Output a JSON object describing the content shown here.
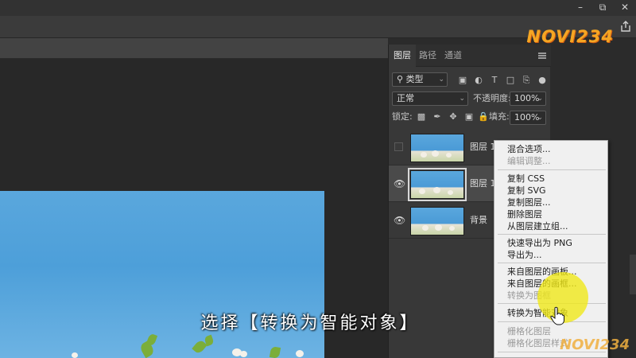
{
  "logo": {
    "text": "NOVI234"
  },
  "panel": {
    "tabs": [
      "图层",
      "路径",
      "通道"
    ],
    "filter": {
      "label": "类型"
    },
    "blend_mode": "正常",
    "opacity": {
      "label": "不透明度:",
      "value": "100%"
    },
    "lock_label": "锁定:",
    "fill": {
      "label": "填充:",
      "value": "100%"
    },
    "layers": [
      {
        "name": "图层 1",
        "visible": false,
        "selected": false
      },
      {
        "name": "图层 1",
        "visible": true,
        "selected": true
      },
      {
        "name": "背景",
        "visible": true,
        "selected": false
      }
    ]
  },
  "context_menu": {
    "groups": [
      [
        {
          "label": "混合选项...",
          "enabled": true
        },
        {
          "label": "编辑调整...",
          "enabled": false
        }
      ],
      [
        {
          "label": "复制 CSS",
          "enabled": true
        },
        {
          "label": "复制 SVG",
          "enabled": true
        },
        {
          "label": "复制图层...",
          "enabled": true
        },
        {
          "label": "删除图层",
          "enabled": true
        },
        {
          "label": "从图层建立组...",
          "enabled": true
        }
      ],
      [
        {
          "label": "快速导出为 PNG",
          "enabled": true
        },
        {
          "label": "导出为...",
          "enabled": true
        }
      ],
      [
        {
          "label": "来自图层的画板...",
          "enabled": true
        },
        {
          "label": "来自图层的画框...",
          "enabled": true
        },
        {
          "label": "转换为图框",
          "enabled": false
        }
      ],
      [
        {
          "label": "转换为智能对象",
          "enabled": true
        }
      ],
      [
        {
          "label": "栅格化图层",
          "enabled": false
        },
        {
          "label": "栅格化图层样式",
          "enabled": false
        }
      ]
    ]
  },
  "subtitle": "选择【转换为智能对象】",
  "colors": {
    "accent_logo": "#f5a623",
    "highlight": "#f0e814",
    "panel_bg": "#383838",
    "sky": "#5aa7dd"
  }
}
